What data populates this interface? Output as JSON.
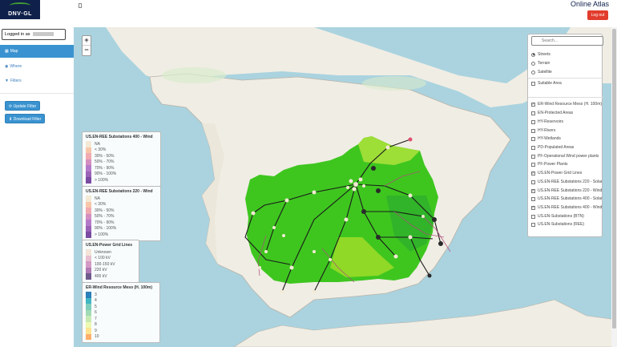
{
  "header": {
    "logo_text": "DNV·GL",
    "app_title": "Online Atlas",
    "logout_label": "Log out"
  },
  "sidebar": {
    "logged_in_label": "Logged in as",
    "nav": [
      {
        "label": "Map",
        "icon": "map-icon"
      },
      {
        "label": "Where",
        "icon": "globe-icon"
      },
      {
        "label": "Filters",
        "icon": "filter-icon"
      }
    ],
    "update_filter_label": "Update Filter",
    "download_filter_label": "Download Filter"
  },
  "map": {
    "zoom_in": "+",
    "zoom_out": "−",
    "search_placeholder": "Search...",
    "base_layers": [
      {
        "label": "Streets",
        "selected": true
      },
      {
        "label": "Terrain",
        "selected": false
      },
      {
        "label": "Satellite",
        "selected": false
      }
    ],
    "overlay_top": [
      {
        "label": "Suitable Area",
        "checked": false
      }
    ],
    "overlays": [
      {
        "label": "ER-Wind Resource Meso (H. 100m)",
        "checked": true
      },
      {
        "label": "EN-Protected Areas",
        "checked": false
      },
      {
        "label": "HY-Reservoirs",
        "checked": false
      },
      {
        "label": "HY-Rivers",
        "checked": false
      },
      {
        "label": "HY-Wetlands",
        "checked": false
      },
      {
        "label": "PD-Populated Areas",
        "checked": false
      },
      {
        "label": "PF-Operational Wind power plants",
        "checked": false
      },
      {
        "label": "PF-Power Plants",
        "checked": false
      },
      {
        "label": "US.EN-Power Grid Lines",
        "checked": true
      },
      {
        "label": "US.EN-REE Substations 220 - Solar",
        "checked": false
      },
      {
        "label": "US.EN-REE Substations 220 - Wind",
        "checked": true
      },
      {
        "label": "US.EN-REE Substations 400 - Solar",
        "checked": false
      },
      {
        "label": "US.EN-REE Substations 400 - Wind",
        "checked": true
      },
      {
        "label": "US.EN-Substations (BTN)",
        "checked": false
      },
      {
        "label": "US.EN-Substations (REE)",
        "checked": false
      }
    ],
    "legends": [
      {
        "title": "US.EN-REE Substations 400 - Wind",
        "items": [
          {
            "label": "NA",
            "color": "#f4e9d4"
          },
          {
            "label": "< 30%",
            "color": "#f7c6a8"
          },
          {
            "label": "30% - 50%",
            "color": "#f1aab0"
          },
          {
            "label": "50% - 70%",
            "color": "#d48fc0"
          },
          {
            "label": "70% - 90%",
            "color": "#b47ac9"
          },
          {
            "label": "90% - 100%",
            "color": "#9a63b8"
          },
          {
            "label": "> 100%",
            "color": "#7a4ba2"
          }
        ]
      },
      {
        "title": "US.EN-REE Substations 220 - Wind",
        "items": [
          {
            "label": "NA",
            "color": "#f4e9d4"
          },
          {
            "label": "< 30%",
            "color": "#f7c6a8"
          },
          {
            "label": "30% - 50%",
            "color": "#f1aab0"
          },
          {
            "label": "50% - 70%",
            "color": "#d48fc0"
          },
          {
            "label": "70% - 90%",
            "color": "#b47ac9"
          },
          {
            "label": "90% - 100%",
            "color": "#9a63b8"
          },
          {
            "label": "> 100%",
            "color": "#7a4ba2"
          }
        ]
      },
      {
        "title": "US.EN-Power Grid Lines",
        "items": [
          {
            "label": "Unknown",
            "color": "#f2e4d6"
          },
          {
            "label": "< 100 kV",
            "color": "#e8bfd0"
          },
          {
            "label": "100-150 kV",
            "color": "#d39ac4"
          },
          {
            "label": "220 kV",
            "color": "#b07ab4"
          },
          {
            "label": "400 kV",
            "color": "#6f5a8c"
          }
        ]
      },
      {
        "title": "ER-Wind Resource Meso (H. 100m)",
        "items": [
          {
            "label": "3",
            "color": "#2c7fb8"
          },
          {
            "label": "4",
            "color": "#41b6c4"
          },
          {
            "label": "5",
            "color": "#7fcdbb"
          },
          {
            "label": "6",
            "color": "#a1dab4"
          },
          {
            "label": "7",
            "color": "#c7e9b4"
          },
          {
            "label": "8",
            "color": "#edf8b1"
          },
          {
            "label": "9",
            "color": "#fee391"
          },
          {
            "label": "10",
            "color": "#fdae6b"
          }
        ]
      }
    ]
  }
}
